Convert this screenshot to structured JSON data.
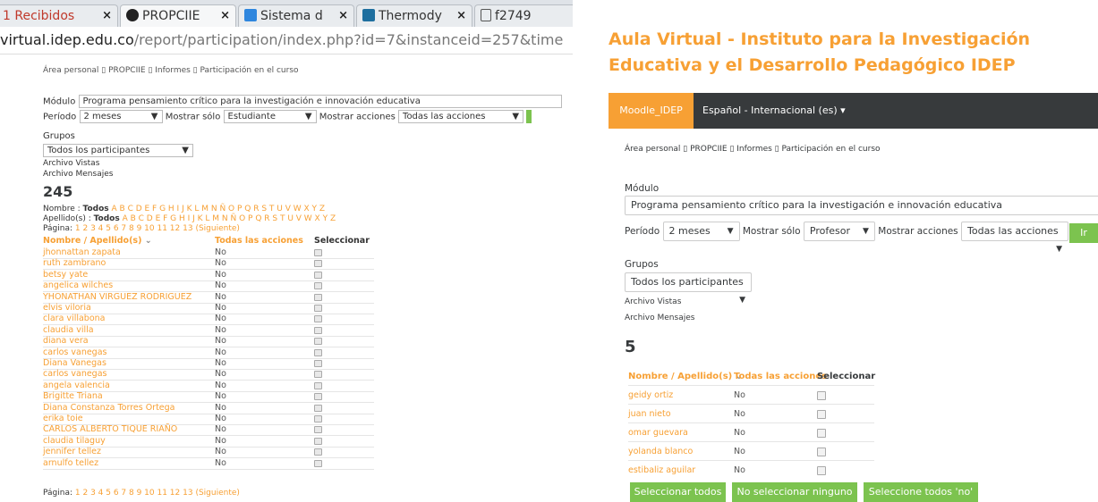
{
  "browser": {
    "tabs": [
      {
        "label": "1 Recibidos",
        "close": "×"
      },
      {
        "label": "PROPCIIE",
        "close": "×"
      },
      {
        "label": "Sistema d",
        "close": "×"
      },
      {
        "label": "Thermody",
        "close": "×"
      },
      {
        "label": "f2749",
        "close": ""
      }
    ],
    "url": "virtual.idep.edu.co",
    "url_path": "/report/participation/index.php?id=7&instanceid=257&time"
  },
  "left": {
    "breadcrumb": "Área personal  ▯ PROPCIIE  ▯ Informes  ▯ Participación en el curso",
    "modulo_label": "Módulo",
    "modulo_value": "Programa pensamiento crítico para la investigación e innovación educativa",
    "periodo_label": "Período",
    "periodo_value": "2 meses",
    "mostrar_solo_label": "Mostrar sólo",
    "mostrar_solo_value": "Estudiante",
    "mostrar_acciones_label": "Mostrar acciones",
    "mostrar_acciones_value": "Todas las acciones",
    "grupos_label": "Grupos",
    "grupos_value": "Todos los participantes",
    "archivo_vistas": "Archivo Vistas",
    "archivo_mensajes": "Archivo Mensajes",
    "count": "245",
    "nombre_label": "Nombre :",
    "apellido_label": "Apellido(s) :",
    "todos": "Todos",
    "letters": "A B C D E F G H I J K L M N Ñ O P Q R S T U V W X Y Z",
    "pagina_label": "Página:",
    "pages": "1 2 3 4 5 6 7 8 9 10 11 12 13",
    "siguiente": "(Siguiente)",
    "col_nombre": "Nombre / Apellido(s)",
    "col_sort": "⌄",
    "col_acciones": "Todas las acciones",
    "col_seleccionar": "Seleccionar",
    "rows": [
      {
        "name": "jhonnattan zapata",
        "val": "No"
      },
      {
        "name": "ruth zambrano",
        "val": "No"
      },
      {
        "name": "betsy yate",
        "val": "No"
      },
      {
        "name": "angelica wilches",
        "val": "No"
      },
      {
        "name": "YHONATHAN VIRGUEZ RODRIGUEZ",
        "val": "No"
      },
      {
        "name": "elvis viloria",
        "val": "No"
      },
      {
        "name": "clara villabona",
        "val": "No"
      },
      {
        "name": "claudia villa",
        "val": "No"
      },
      {
        "name": "diana vera",
        "val": "No"
      },
      {
        "name": "carlos vanegas",
        "val": "No"
      },
      {
        "name": "Diana Vanegas",
        "val": "No"
      },
      {
        "name": "carlos vanegas",
        "val": "No"
      },
      {
        "name": "angela valencia",
        "val": "No"
      },
      {
        "name": "Brigitte Triana",
        "val": "No"
      },
      {
        "name": "Diana Constanza Torres Ortega",
        "val": "No"
      },
      {
        "name": "erika toie",
        "val": "No"
      },
      {
        "name": "CARLOS ALBERTO TIQUE RIAÑO",
        "val": "No"
      },
      {
        "name": "claudia tilaguy",
        "val": "No"
      },
      {
        "name": "jennifer tellez",
        "val": "No"
      },
      {
        "name": "arnulfo tellez",
        "val": "No"
      }
    ],
    "footer_pagina": "Página:"
  },
  "right": {
    "title": "Aula Virtual - Instituto para la Investigación Educativa y el Desarrollo Pedagógico IDEP",
    "brand": "Moodle_IDEP",
    "language": "Español - Internacional (es) ▾",
    "breadcrumb": "Área personal  ▯ PROPCIIE  ▯ Informes  ▯ Participación en el curso",
    "modulo_label": "Módulo",
    "modulo_value": "Programa pensamiento crítico para la investigación e innovación educativa",
    "periodo_label": "Período",
    "periodo_value": "2 meses",
    "mostrar_solo_label": "Mostrar sólo",
    "mostrar_solo_value": "Profesor",
    "mostrar_acciones_label": "Mostrar acciones",
    "mostrar_acciones_value": "Todas las acciones",
    "ir_button": "Ir",
    "grupos_label": "Grupos",
    "grupos_value": "Todos los participantes",
    "archivo_vistas": "Archivo Vistas",
    "archivo_mensajes": "Archivo Mensajes",
    "count": "5",
    "col_nombre": "Nombre / Apellido(s)",
    "col_sort": "⌄",
    "col_acciones": "Todas las acciones",
    "col_seleccionar": "Seleccionar",
    "rows": [
      {
        "name": "geidy ortiz",
        "val": "No"
      },
      {
        "name": "juan nieto",
        "val": "No"
      },
      {
        "name": "omar guevara",
        "val": "No"
      },
      {
        "name": "yolanda blanco",
        "val": "No"
      },
      {
        "name": "estibaliz aguilar",
        "val": "No"
      }
    ],
    "btn_select_all": "Seleccionar todos",
    "btn_select_none": "No seleccionar ninguno",
    "btn_select_no": "Seleccione todos 'no'"
  },
  "colors": {
    "accent": "#f7a034",
    "navbar": "#373a3c",
    "green": "#7cc34f"
  }
}
